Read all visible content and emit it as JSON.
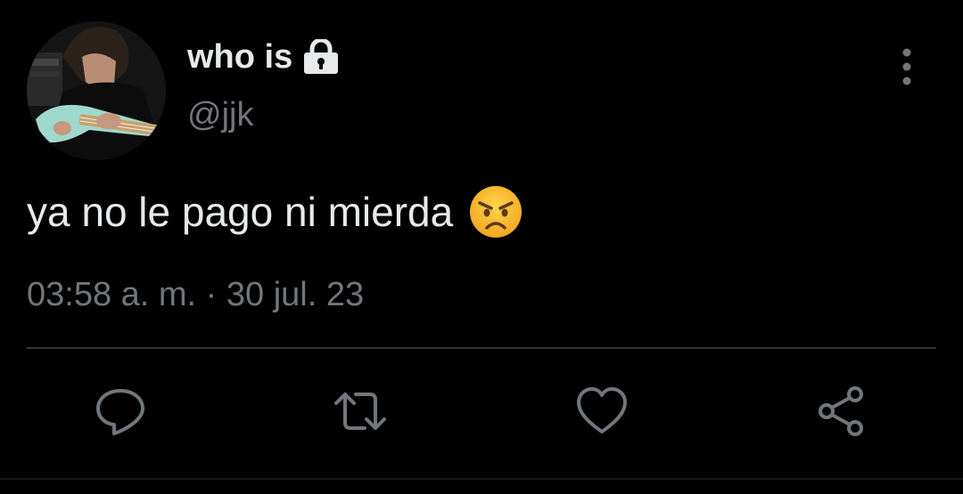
{
  "tweet": {
    "author": {
      "display_name": "who is",
      "handle": "@jjk",
      "protected_icon": "lock-icon",
      "avatar": "avatar-photo-bassist"
    },
    "text": "ya no le pago ni mierda",
    "emoji": "angry-face-emoji",
    "timestamp": "03:58 a. m. · 30 jul. 23"
  },
  "menu": {
    "icon": "more-vertical-icon"
  },
  "actions": [
    {
      "name": "reply",
      "icon": "reply-icon"
    },
    {
      "name": "retweet",
      "icon": "retweet-icon"
    },
    {
      "name": "like",
      "icon": "heart-icon"
    },
    {
      "name": "share",
      "icon": "share-icon"
    }
  ],
  "theme": {
    "background": "#000000",
    "text_primary": "#e7e9ea",
    "text_secondary": "#71767b",
    "divider": "#2f3336"
  }
}
